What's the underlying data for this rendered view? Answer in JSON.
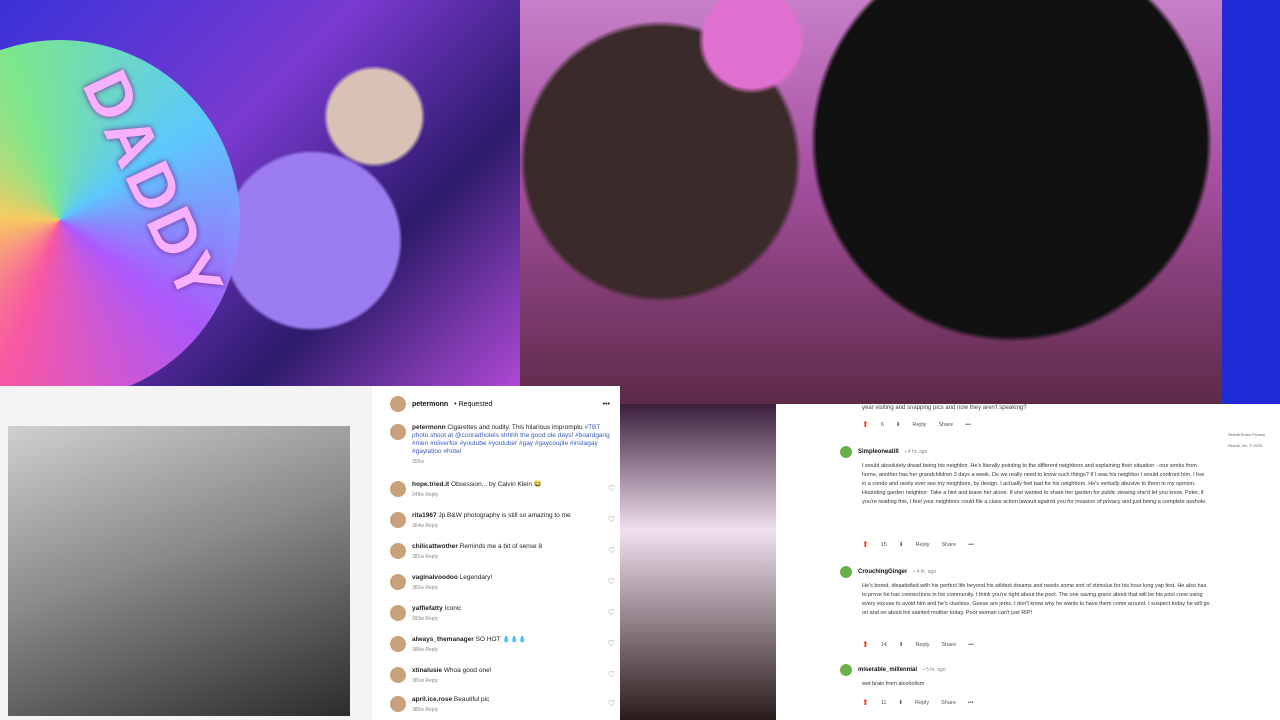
{
  "collage": {
    "fan_text": "DADDY",
    "instagram": {
      "username": "petermonn",
      "header_suffix": "• Requested",
      "caption_user": "petermonn",
      "caption_text": "Cigarettes and nudity. This hilarious impromptu",
      "caption_tags": "#TBT photo shoot at @conradhotels shhhh the good ole days! #boardgang #men #oliverfox #youtube #youtuber #gay #gaycouple #instagay #gaylatino #hotel",
      "caption_time": "355w",
      "comments": [
        {
          "user": "hope.tried.it",
          "text": "Obsession... by Calvin Klein 😂",
          "meta": "248w   Reply"
        },
        {
          "user": "rita1967",
          "text": "Jp B&W photography is still so amazing to me",
          "meta": "364w   Reply"
        },
        {
          "user": "chilicattwother",
          "text": "Reminds me a bit of sense 8",
          "meta": "381w   Reply"
        },
        {
          "user": "vaginalvoodoo",
          "text": "Legendary!",
          "meta": "382w   Reply"
        },
        {
          "user": "yaffiefatty",
          "text": "Iconic",
          "meta": "393w   Reply"
        },
        {
          "user": "always_themanager",
          "text": "SO HOT 💧💧💧",
          "meta": "386w   Reply"
        },
        {
          "user": "xtinalusie",
          "text": "Whoa good one!",
          "meta": "381w   Reply"
        },
        {
          "user": "april.ice.rose",
          "text": "Beautiful pic",
          "meta": "385w   Reply"
        }
      ]
    },
    "reddit": {
      "top_line": "year visiting and snapping pics and now they aren't speaking?",
      "top_actions": {
        "votes": "6",
        "reply": "Reply",
        "share": "Share",
        "more": "•••"
      },
      "comments": [
        {
          "author": "Simpleoneatill",
          "time": "• 4 hr. ago",
          "body": "I would absolutely dread being his neighbor. He's literally pointing to the different neighbors and explaining their situation - one works from home, another has her grandchildren 3 days a week. Do we really need to know such things? If I was his neighbor I would confront him. I live in a condo and rarely ever see my neighbors, by design. I actually feel bad for his neighbors. He's verbally abusive to them in my opinion. Hounding garden neighbor: Take a hint and leave her alone. If she wanted to share her garden for public viewing she'd let you know. Peter, if you're reading this, I feel your neighbors could file a class action lawsuit against you for invasion of privacy and just being a complete asshole.",
          "votes": "15",
          "reply": "Reply",
          "share": "Share"
        },
        {
          "author": "CrouchingGinger",
          "time": "• 4 hr. ago",
          "body": "He's bored, dissatisfied with his perfect life beyond his wildest dreams and needs some sort of stimulus for his hour long yap fest. He also has to prove he has connections in his community. I think you're right about the pool. The one saving grace about that will be his pool crew using every excuse to avoid him and he's clueless. Geese are jerks. I don't know why he wants to have them come around. I suspect today he will go on and on about his sainted mother today. Poor woman can't just RIP!",
          "votes": "14",
          "reply": "Reply",
          "share": "Share"
        },
        {
          "author": "miserable_millennial",
          "time": "• 5 hr. ago",
          "body": "wet brain from alcoholism",
          "votes": "11",
          "reply": "Reply",
          "share": "Share"
        }
      ],
      "sidebar": [
        "Reddit Rules   Privacy",
        "Reddit, Inc. © 2025"
      ]
    }
  }
}
